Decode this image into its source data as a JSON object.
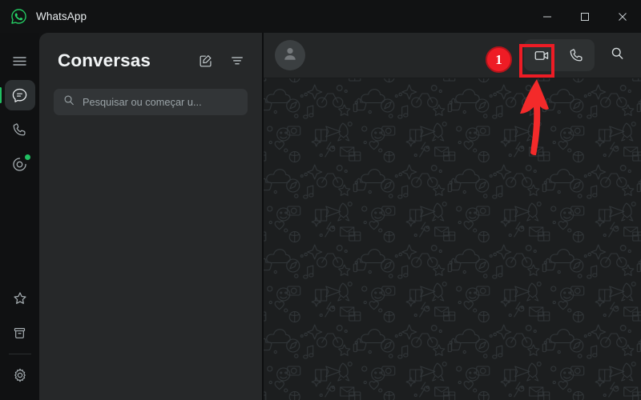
{
  "window": {
    "app_name": "WhatsApp",
    "logo_icon": "whatsapp-logo",
    "controls": {
      "minimize_label": "—",
      "minimize_icon": "minimize-icon",
      "maximize_label": "▢",
      "maximize_icon": "maximize-icon",
      "close_label": "✕",
      "close_icon": "close-icon"
    }
  },
  "rail": {
    "items": [
      {
        "name": "menu",
        "icon": "hamburger-menu-icon",
        "active": false,
        "dot": false
      },
      {
        "name": "chats",
        "icon": "chat-bubble-icon",
        "active": true,
        "dot": false
      },
      {
        "name": "calls",
        "icon": "phone-icon",
        "active": false,
        "dot": false
      },
      {
        "name": "status",
        "icon": "status-circle-icon",
        "active": false,
        "dot": true
      },
      {
        "name": "starred",
        "icon": "star-icon",
        "active": false,
        "dot": false
      },
      {
        "name": "archived",
        "icon": "archive-box-icon",
        "active": false,
        "dot": false
      },
      {
        "name": "settings",
        "icon": "gear-icon",
        "active": false,
        "dot": false
      }
    ]
  },
  "chat_list": {
    "title": "Conversas",
    "new_chat_icon": "compose-new-chat-icon",
    "filter_icon": "filter-icon",
    "search": {
      "placeholder": "Pesquisar ou começar u...",
      "value": "",
      "icon": "search-icon"
    }
  },
  "conversation": {
    "avatar_icon": "default-person-avatar-icon",
    "contact_name": "",
    "actions": {
      "video_call_icon": "video-camera-icon",
      "voice_call_icon": "phone-handset-icon",
      "search_icon": "search-icon"
    },
    "wallpaper": "whatsapp-doodle-pattern"
  },
  "annotations": {
    "step_badge": "1",
    "highlight_target": "video-call-button",
    "arrow_icon": "up-arrow-annotation"
  },
  "colors": {
    "accent_green": "#21c063",
    "annotation_red": "#ee1c25",
    "annotation_red_dark": "#b3141b",
    "titlebar_bg": "#111213",
    "rail_bg": "#101112",
    "panel_bg": "#262829",
    "conversation_bg": "#1c1e1f",
    "conversation_header_bg": "#242627",
    "text_primary": "#e9edef",
    "text_secondary": "#9aa3a7"
  }
}
